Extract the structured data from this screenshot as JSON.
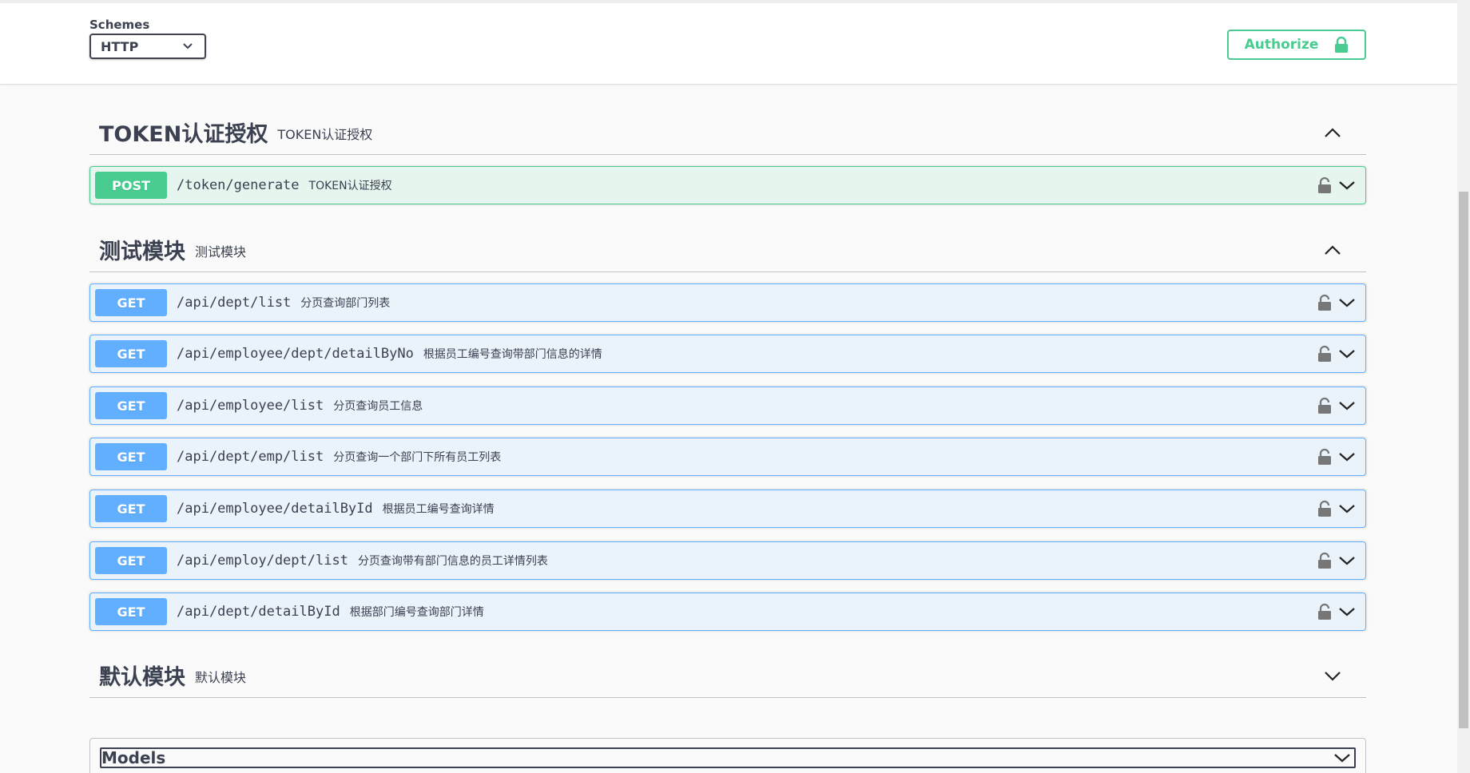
{
  "schemes": {
    "label": "Schemes",
    "selected": "HTTP"
  },
  "authorize": {
    "label": "Authorize"
  },
  "colors": {
    "get": "#61affe",
    "post": "#49cc90",
    "text": "#3b4151"
  },
  "tags": [
    {
      "title": "TOKEN认证授权",
      "description": "TOKEN认证授权",
      "expanded": true,
      "operations": [
        {
          "method": "POST",
          "path": "/token/generate",
          "summary": "TOKEN认证授权"
        }
      ]
    },
    {
      "title": "测试模块",
      "description": "测试模块",
      "expanded": true,
      "operations": [
        {
          "method": "GET",
          "path": "/api/dept/list",
          "summary": "分页查询部门列表"
        },
        {
          "method": "GET",
          "path": "/api/employee/dept/detailByNo",
          "summary": "根据员工编号查询带部门信息的详情"
        },
        {
          "method": "GET",
          "path": "/api/employee/list",
          "summary": "分页查询员工信息"
        },
        {
          "method": "GET",
          "path": "/api/dept/emp/list",
          "summary": "分页查询一个部门下所有员工列表"
        },
        {
          "method": "GET",
          "path": "/api/employee/detailById",
          "summary": "根据员工编号查询详情"
        },
        {
          "method": "GET",
          "path": "/api/employ/dept/list",
          "summary": "分页查询带有部门信息的员工详情列表"
        },
        {
          "method": "GET",
          "path": "/api/dept/detailById",
          "summary": "根据部门编号查询部门详情"
        }
      ]
    },
    {
      "title": "默认模块",
      "description": "默认模块",
      "expanded": false,
      "operations": []
    }
  ],
  "models": {
    "label": "Models"
  }
}
